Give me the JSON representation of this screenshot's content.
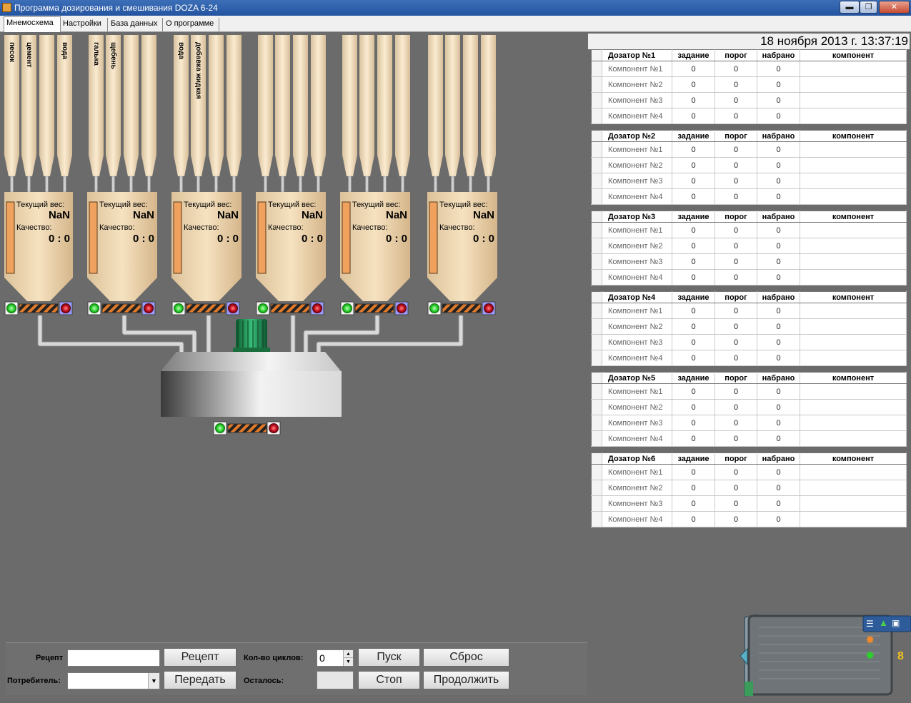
{
  "window": {
    "title": "Программа дозирования и смешивания DOZA 6-24"
  },
  "tabs": [
    {
      "label": "Мнемосхема"
    },
    {
      "label": "Настройки"
    },
    {
      "label": "База данных"
    },
    {
      "label": "О программе"
    }
  ],
  "datetime": "18 ноября 2013 г. 13:37:19",
  "hoppers": [
    {
      "weight_label": "Текущий вес:",
      "weight": "NaN",
      "quality_label": "Качество:",
      "quality": "0 : 0",
      "silos": [
        "песок",
        "цемент",
        "",
        "вода"
      ]
    },
    {
      "weight_label": "Текущий вес:",
      "weight": "NaN",
      "quality_label": "Качество:",
      "quality": "0 : 0",
      "silos": [
        "галька",
        "щебень",
        "",
        ""
      ]
    },
    {
      "weight_label": "Текущий вес:",
      "weight": "NaN",
      "quality_label": "Качество:",
      "quality": "0 : 0",
      "silos": [
        "вода",
        "добавка жидкая",
        "",
        ""
      ]
    },
    {
      "weight_label": "Текущий вес:",
      "weight": "NaN",
      "quality_label": "Качество:",
      "quality": "0 : 0",
      "silos": [
        "",
        "",
        "",
        ""
      ]
    },
    {
      "weight_label": "Текущий вес:",
      "weight": "NaN",
      "quality_label": "Качество:",
      "quality": "0 : 0",
      "silos": [
        "",
        "",
        "",
        ""
      ]
    },
    {
      "weight_label": "Текущий вес:",
      "weight": "NaN",
      "quality_label": "Качество:",
      "quality": "0 : 0",
      "silos": [
        "",
        "",
        "",
        ""
      ]
    }
  ],
  "dosers": [
    {
      "name": "Дозатор №1",
      "columns": [
        "задание",
        "порог",
        "набрано",
        "компонент"
      ],
      "rows": [
        {
          "name": "Компонент №1",
          "v": [
            "0",
            "0",
            "0"
          ]
        },
        {
          "name": "Компонент №2",
          "v": [
            "0",
            "0",
            "0"
          ]
        },
        {
          "name": "Компонент №3",
          "v": [
            "0",
            "0",
            "0"
          ]
        },
        {
          "name": "Компонент №4",
          "v": [
            "0",
            "0",
            "0"
          ]
        }
      ]
    },
    {
      "name": "Дозатор №2",
      "columns": [
        "задание",
        "порог",
        "набрано",
        "компонент"
      ],
      "rows": [
        {
          "name": "Компонент №1",
          "v": [
            "0",
            "0",
            "0"
          ]
        },
        {
          "name": "Компонент №2",
          "v": [
            "0",
            "0",
            "0"
          ]
        },
        {
          "name": "Компонент №3",
          "v": [
            "0",
            "0",
            "0"
          ]
        },
        {
          "name": "Компонент №4",
          "v": [
            "0",
            "0",
            "0"
          ]
        }
      ]
    },
    {
      "name": "Дозатор №3",
      "columns": [
        "задание",
        "порог",
        "набрано",
        "компонент"
      ],
      "rows": [
        {
          "name": "Компонент №1",
          "v": [
            "0",
            "0",
            "0"
          ]
        },
        {
          "name": "Компонент №2",
          "v": [
            "0",
            "0",
            "0"
          ]
        },
        {
          "name": "Компонент №3",
          "v": [
            "0",
            "0",
            "0"
          ]
        },
        {
          "name": "Компонент №4",
          "v": [
            "0",
            "0",
            "0"
          ]
        }
      ]
    },
    {
      "name": "Дозатор №4",
      "columns": [
        "задание",
        "порог",
        "набрано",
        "компонент"
      ],
      "rows": [
        {
          "name": "Компонент №1",
          "v": [
            "0",
            "0",
            "0"
          ]
        },
        {
          "name": "Компонент №2",
          "v": [
            "0",
            "0",
            "0"
          ]
        },
        {
          "name": "Компонент №3",
          "v": [
            "0",
            "0",
            "0"
          ]
        },
        {
          "name": "Компонент №4",
          "v": [
            "0",
            "0",
            "0"
          ]
        }
      ]
    },
    {
      "name": "Дозатор №5",
      "columns": [
        "задание",
        "порог",
        "набрано",
        "компонент"
      ],
      "rows": [
        {
          "name": "Компонент №1",
          "v": [
            "0",
            "0",
            "0"
          ]
        },
        {
          "name": "Компонент №2",
          "v": [
            "0",
            "0",
            "0"
          ]
        },
        {
          "name": "Компонент №3",
          "v": [
            "0",
            "0",
            "0"
          ]
        },
        {
          "name": "Компонент №4",
          "v": [
            "0",
            "0",
            "0"
          ]
        }
      ]
    },
    {
      "name": "Дозатор №6",
      "columns": [
        "задание",
        "порог",
        "набрано",
        "компонент"
      ],
      "rows": [
        {
          "name": "Компонент №1",
          "v": [
            "0",
            "0",
            "0"
          ]
        },
        {
          "name": "Компонент №2",
          "v": [
            "0",
            "0",
            "0"
          ]
        },
        {
          "name": "Компонент №3",
          "v": [
            "0",
            "0",
            "0"
          ]
        },
        {
          "name": "Компонент №4",
          "v": [
            "0",
            "0",
            "0"
          ]
        }
      ]
    }
  ],
  "controls": {
    "recipe_label": "Рецепт",
    "recipe_value": "",
    "consumer_label": "Потребитель:",
    "consumer_value": "",
    "recipe_button": "Рецепт",
    "send_button": "Передать",
    "cycles_label": "Кол-во циклов:",
    "cycles_value": "0",
    "remaining_label": "Осталось:",
    "remaining_value": "",
    "start_button": "Пуск",
    "stop_button": "Стоп",
    "reset_button": "Сброс",
    "continue_button": "Продолжить"
  },
  "widget": {
    "counter": "8"
  },
  "colors": {
    "silo": "#f4dfbe",
    "hopper": "#eed3aa",
    "level_bar": "#f0a15e",
    "lamp_on": "#2bd12b",
    "lamp_off": "#cc1020",
    "motor": "#2aa05a",
    "background": "#6b6b6b"
  }
}
